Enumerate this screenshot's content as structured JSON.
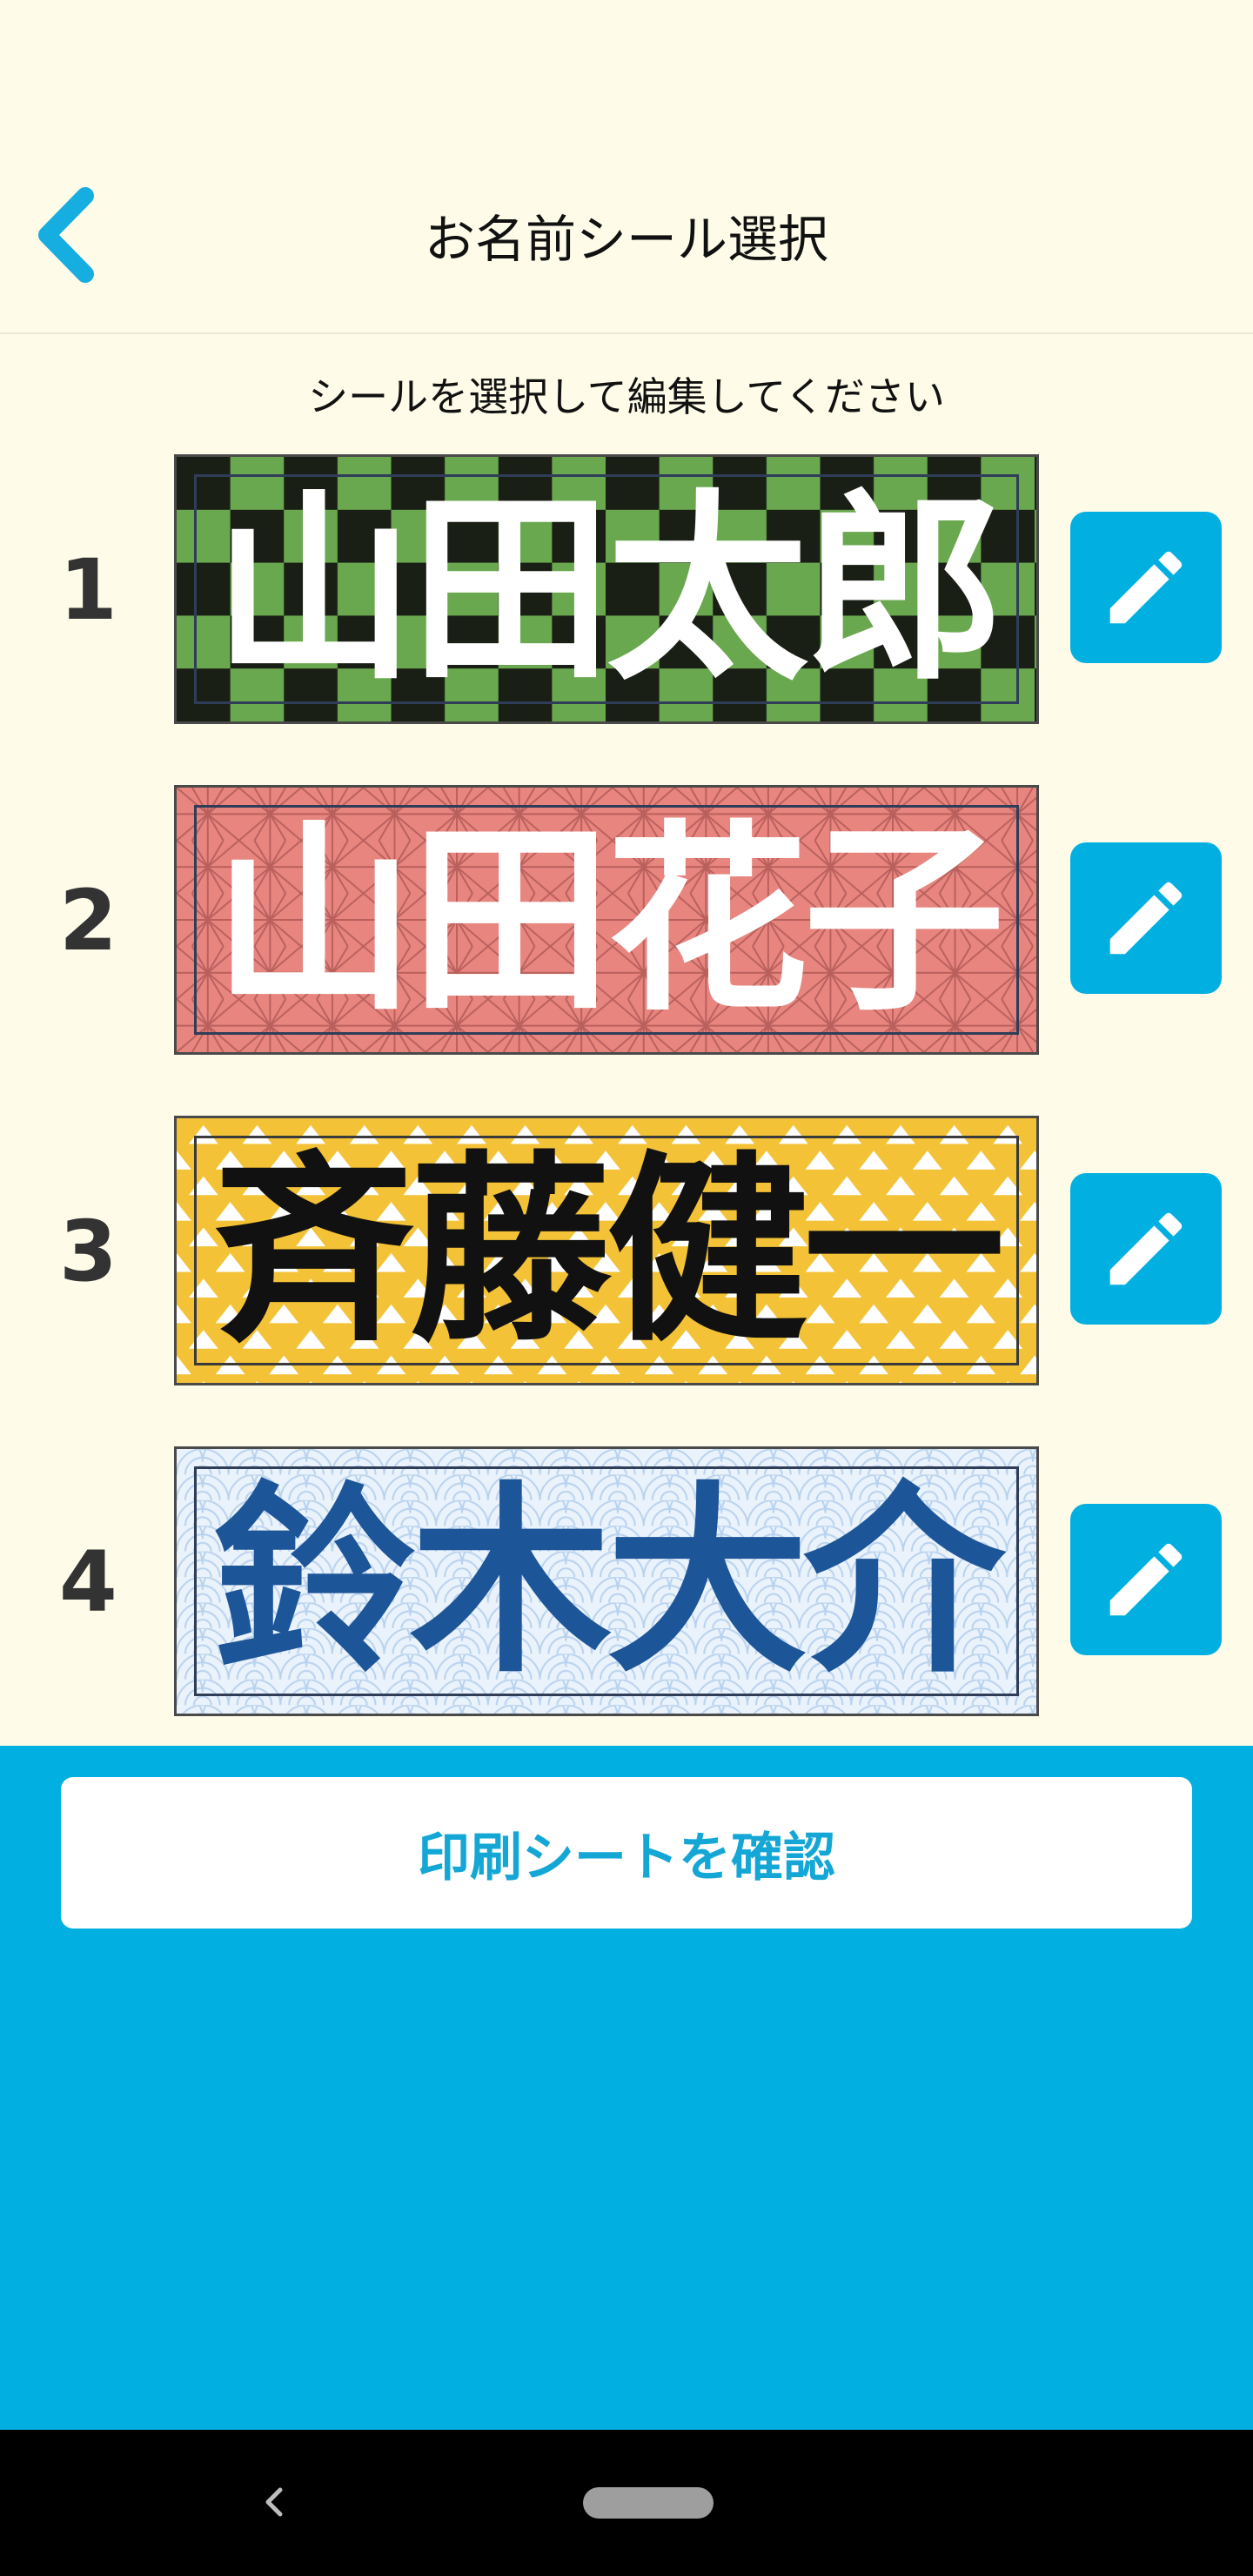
{
  "header": {
    "title": "お名前シール選択"
  },
  "subtitle": "シールを選択して編集してください",
  "stickers": [
    {
      "number": "1",
      "name": "山田太郎",
      "pattern": "checker-green",
      "text_color": "#ffffff"
    },
    {
      "number": "2",
      "name": "山田花子",
      "pattern": "asanoha-pink",
      "text_color": "#ffffff"
    },
    {
      "number": "3",
      "name": "斉藤健一",
      "pattern": "triangles-yellow",
      "text_color": "#111111"
    },
    {
      "number": "4",
      "name": "鈴木大介",
      "pattern": "waves-blue",
      "text_color": "#1d5599"
    }
  ],
  "footer": {
    "confirm_label": "印刷シートを確認"
  },
  "colors": {
    "accent": "#01b0e0",
    "background": "#fefce9"
  }
}
